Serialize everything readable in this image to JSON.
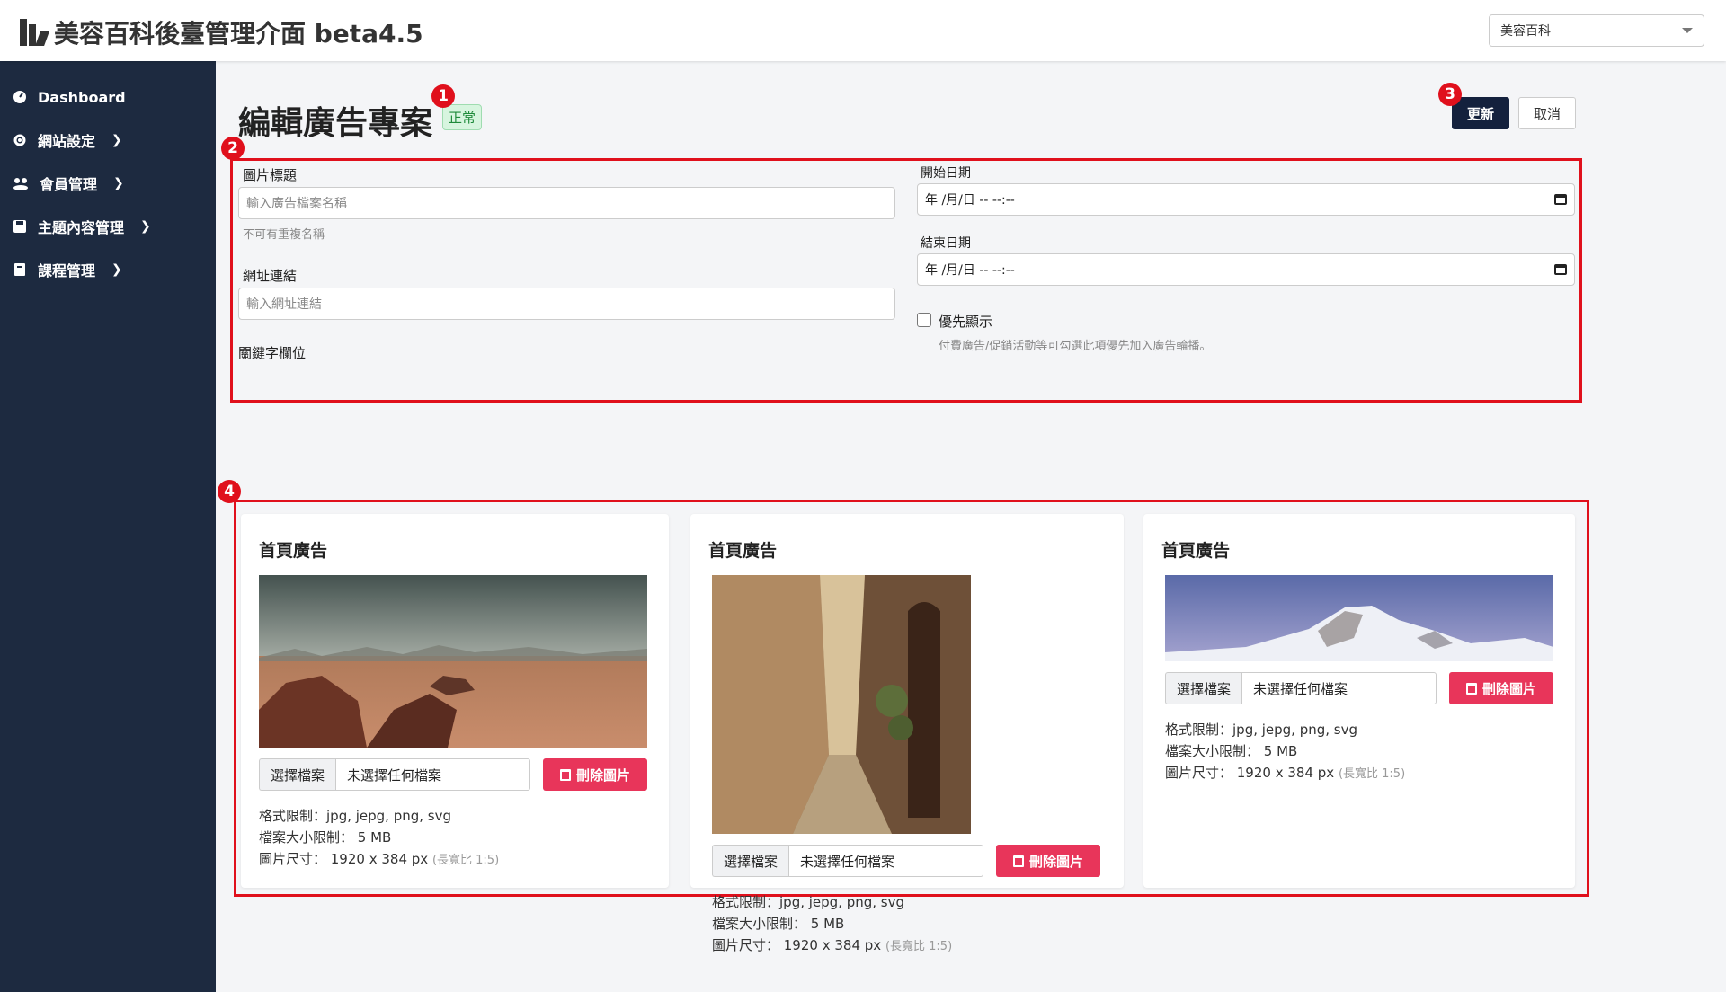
{
  "app": {
    "title": "美容百科後臺管理介面 beta4.5",
    "site_selector": "美容百科"
  },
  "sidebar": {
    "items": [
      {
        "label": "Dashboard"
      },
      {
        "label": "網站設定"
      },
      {
        "label": "會員管理"
      },
      {
        "label": "主題內容管理"
      },
      {
        "label": "課程管理"
      }
    ]
  },
  "page": {
    "title": "編輯廣告專案",
    "status_badge": "正常",
    "update_label": "更新",
    "cancel_label": "取消"
  },
  "markers": [
    "1",
    "2",
    "3",
    "4"
  ],
  "form": {
    "image_title_label": "圖片標題",
    "image_title_placeholder": "輸入廣告檔案名稱",
    "image_title_help": "不可有重複名稱",
    "url_label": "網址連結",
    "url_placeholder": "輸入網址連結",
    "keywords_label": "關鍵字欄位",
    "start_date_label": "開始日期",
    "start_date_value": "年 /月/日 -- --:--",
    "end_date_label": "結束日期",
    "end_date_value": "年 /月/日 -- --:--",
    "priority_label": "優先顯示",
    "priority_checked": false,
    "priority_help": "付費廣告/促銷活動等可勾選此項優先加入廣告輪播。"
  },
  "cards": [
    {
      "title": "首頁廣告",
      "choose_file": "選擇檔案",
      "file_name": "未選擇任何檔案",
      "delete_label": "刪除圖片",
      "format": "格式限制：jpg, jepg, png, svg",
      "size": "檔案大小限制： 5 MB",
      "dimension": "圖片尺寸： 1920 x 384 px",
      "ratio": "(長寬比 1:5)"
    },
    {
      "title": "首頁廣告",
      "choose_file": "選擇檔案",
      "file_name": "未選擇任何檔案",
      "delete_label": "刪除圖片",
      "format": "格式限制：jpg, jepg, png, svg",
      "size": "檔案大小限制： 5 MB",
      "dimension": "圖片尺寸： 1920 x 384 px",
      "ratio": "(長寬比 1:5)"
    },
    {
      "title": "首頁廣告",
      "choose_file": "選擇檔案",
      "file_name": "未選擇任何檔案",
      "delete_label": "刪除圖片",
      "format": "格式限制：jpg, jepg, png, svg",
      "size": "檔案大小限制： 5 MB",
      "dimension": "圖片尺寸： 1920 x 384 px",
      "ratio": "(長寬比 1:5)"
    }
  ],
  "colors": {
    "sidebar_bg": "#1d2a40",
    "primary": "#14213d",
    "danger": "#e8355a",
    "annotation": "#e0101c",
    "status_success": "#1e8a3a"
  }
}
